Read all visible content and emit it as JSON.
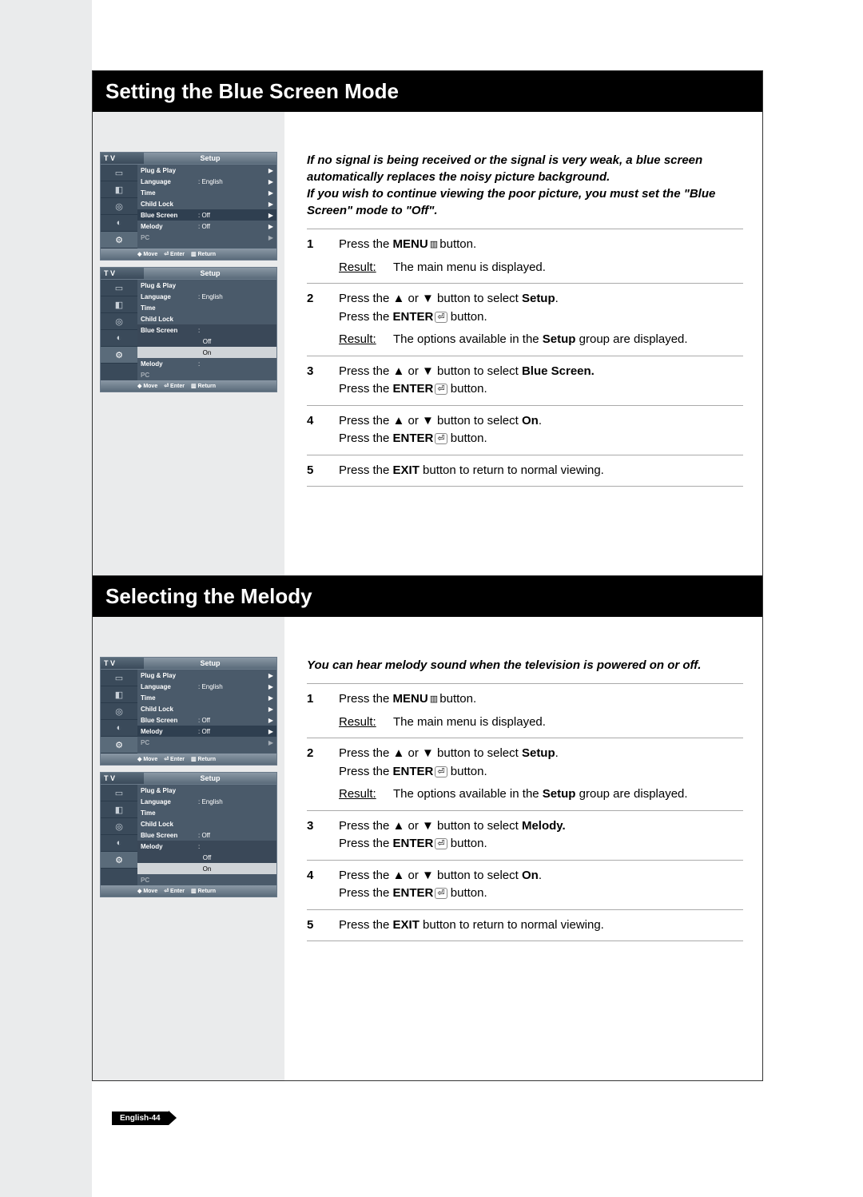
{
  "page_number": "English-44",
  "sections": [
    {
      "title": "Setting the Blue Screen Mode",
      "intro": "If no signal is being received or the signal is very weak, a blue screen automatically replaces the noisy picture background.\nIf you wish to continue viewing the poor picture, you must set the \"Blue Screen\" mode to \"Off\".",
      "steps": [
        {
          "num": "1",
          "t1": "Press the ",
          "b1": "MENU",
          "t2": " button.",
          "result": "The main menu is displayed."
        },
        {
          "num": "2",
          "t1": "Press the ▲ or ▼ button to select ",
          "b1": "Setup",
          "t2": ".\nPress the ",
          "b2": "ENTER",
          "t3": " button.",
          "result": "The options available in the Setup group are displayed.",
          "result_bold": "Setup"
        },
        {
          "num": "3",
          "t1": "Press the ▲ or ▼ button to select ",
          "b1": "Blue Screen.",
          "t2": "\nPress the ",
          "b2": "ENTER",
          "t3": " button."
        },
        {
          "num": "4",
          "t1": "Press the ▲ or ▼ button to select ",
          "b1": "On",
          "t2": ".\nPress the ",
          "b2": "ENTER",
          "t3": " button."
        },
        {
          "num": "5",
          "t1": "Press the ",
          "b1": "EXIT",
          "t2": " button to return to normal viewing."
        }
      ],
      "osd": [
        {
          "title": "Setup",
          "rows": [
            {
              "label": "Plug & Play",
              "val": "",
              "arr": "▶"
            },
            {
              "label": "Language",
              "val": ": English",
              "arr": "▶"
            },
            {
              "label": "Time",
              "val": "",
              "arr": "▶"
            },
            {
              "label": "Child Lock",
              "val": "",
              "arr": "▶"
            },
            {
              "label": "Blue Screen",
              "val": ": Off",
              "arr": "▶",
              "hl": true
            },
            {
              "label": "Melody",
              "val": ": Off",
              "arr": "▶"
            },
            {
              "label": "PC",
              "val": "",
              "arr": "▶",
              "dim": true
            }
          ],
          "footer": [
            "◆ Move",
            "⏎ Enter",
            "▥ Return"
          ]
        },
        {
          "title": "Setup",
          "rows": [
            {
              "label": "Plug & Play",
              "val": "",
              "arr": ""
            },
            {
              "label": "Language",
              "val": ": English",
              "arr": ""
            },
            {
              "label": "Time",
              "val": "",
              "arr": ""
            },
            {
              "label": "Child Lock",
              "val": "",
              "arr": ""
            },
            {
              "label": "Blue Screen",
              "val": ":",
              "arr": "",
              "sub": true,
              "opts": [
                "Off",
                "On"
              ],
              "sel": "On"
            },
            {
              "label": "Melody",
              "val": ":",
              "arr": ""
            },
            {
              "label": "PC",
              "val": "",
              "arr": "",
              "dim": true
            }
          ],
          "footer": [
            "◆ Move",
            "⏎ Enter",
            "▥ Return"
          ]
        }
      ]
    },
    {
      "title": "Selecting the Melody",
      "intro": "You can hear melody sound when the television is powered on or off.",
      "steps": [
        {
          "num": "1",
          "t1": "Press the ",
          "b1": "MENU",
          "t2": " button.",
          "result": "The main menu is displayed."
        },
        {
          "num": "2",
          "t1": "Press the ▲ or ▼ button to select ",
          "b1": "Setup",
          "t2": ".\nPress the ",
          "b2": "ENTER",
          "t3": " button.",
          "result": "The options available in the Setup group are displayed.",
          "result_bold": "Setup"
        },
        {
          "num": "3",
          "t1": "Press the ▲ or ▼ button to select ",
          "b1": "Melody.",
          "t2": "\nPress the ",
          "b2": "ENTER",
          "t3": " button."
        },
        {
          "num": "4",
          "t1": "Press the ▲ or ▼ button to select ",
          "b1": "On",
          "t2": ".\nPress the ",
          "b2": "ENTER",
          "t3": " button."
        },
        {
          "num": "5",
          "t1": "Press the ",
          "b1": "EXIT",
          "t2": " button to return to normal viewing."
        }
      ],
      "osd": [
        {
          "title": "Setup",
          "rows": [
            {
              "label": "Plug & Play",
              "val": "",
              "arr": "▶"
            },
            {
              "label": "Language",
              "val": ": English",
              "arr": "▶"
            },
            {
              "label": "Time",
              "val": "",
              "arr": "▶"
            },
            {
              "label": "Child Lock",
              "val": "",
              "arr": "▶"
            },
            {
              "label": "Blue Screen",
              "val": ": Off",
              "arr": "▶"
            },
            {
              "label": "Melody",
              "val": ": Off",
              "arr": "▶",
              "hl": true
            },
            {
              "label": "PC",
              "val": "",
              "arr": "▶",
              "dim": true
            }
          ],
          "footer": [
            "◆ Move",
            "⏎ Enter",
            "▥ Return"
          ]
        },
        {
          "title": "Setup",
          "rows": [
            {
              "label": "Plug & Play",
              "val": "",
              "arr": ""
            },
            {
              "label": "Language",
              "val": ": English",
              "arr": ""
            },
            {
              "label": "Time",
              "val": "",
              "arr": ""
            },
            {
              "label": "Child Lock",
              "val": "",
              "arr": ""
            },
            {
              "label": "Blue Screen",
              "val": ": Off",
              "arr": ""
            },
            {
              "label": "Melody",
              "val": ":",
              "arr": "",
              "sub": true,
              "opts": [
                "Off",
                "On"
              ],
              "sel": "On",
              "hl": true
            },
            {
              "label": "PC",
              "val": "",
              "arr": "",
              "dim": true
            }
          ],
          "footer": [
            "◆ Move",
            "⏎ Enter",
            "▥ Return"
          ]
        }
      ]
    }
  ],
  "osd_tv_label": "T V",
  "osd_icons": [
    "▭",
    "◧",
    "◎",
    "◐",
    "⚙"
  ]
}
